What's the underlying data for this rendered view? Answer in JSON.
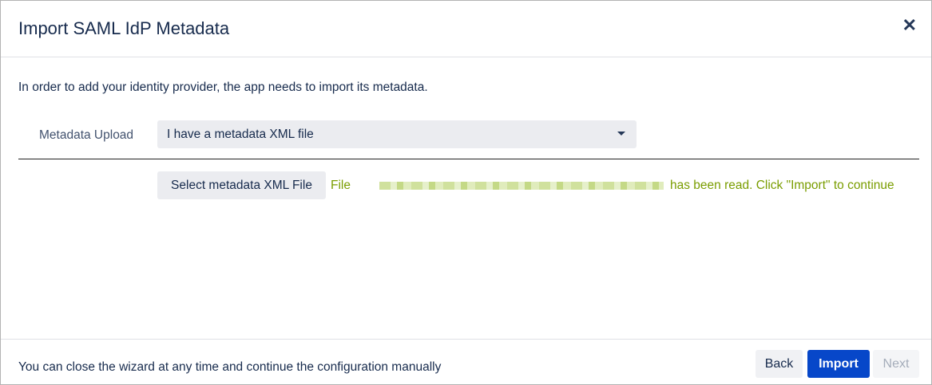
{
  "dialog": {
    "title": "Import SAML IdP Metadata",
    "close_icon": "close-icon"
  },
  "body": {
    "intro": "In order to add your identity provider, the app needs to import its metadata.",
    "metadata_upload_label": "Metadata Upload",
    "metadata_upload_value": "I have a metadata XML file",
    "select_file_button": "Select metadata XML File",
    "file_prefix": "File",
    "file_status": "has been read. Click \"Import\" to continue"
  },
  "footer": {
    "note": "You can close the wizard at any time and continue the configuration manually",
    "back": "Back",
    "import": "Import",
    "next": "Next"
  },
  "colors": {
    "primary": "#0747c9",
    "success_text": "#7a9d00"
  }
}
